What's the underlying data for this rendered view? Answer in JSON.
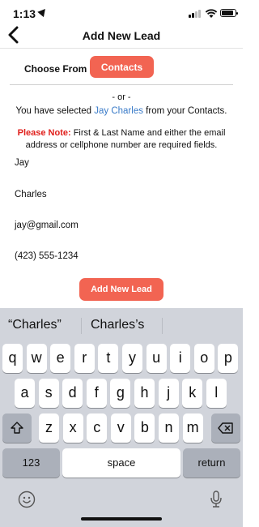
{
  "status": {
    "time": "1:13"
  },
  "nav": {
    "title": "Add New Lead"
  },
  "choose": {
    "label": "Choose From",
    "button": "Contacts"
  },
  "or_text": "- or -",
  "selected": {
    "prefix": "You have selected ",
    "name": "Jay Charles",
    "suffix": " from your Contacts."
  },
  "note": {
    "label": "Please Note:",
    "text": " First & Last Name and either the email address or cellphone number are required fields."
  },
  "fields": {
    "first_name": "Jay",
    "last_name": "Charles",
    "email": "jay@gmail.com",
    "phone": "(423) 555-1234"
  },
  "add_button": "Add New Lead",
  "keyboard": {
    "suggestions": [
      "“Charles”",
      "Charles’s"
    ],
    "row1": [
      "q",
      "w",
      "e",
      "r",
      "t",
      "y",
      "u",
      "i",
      "o",
      "p"
    ],
    "row2": [
      "a",
      "s",
      "d",
      "f",
      "g",
      "h",
      "j",
      "k",
      "l"
    ],
    "row3": [
      "z",
      "x",
      "c",
      "v",
      "b",
      "n",
      "m"
    ],
    "numbers_key": "123",
    "space_key": "space",
    "return_key": "return"
  },
  "colors": {
    "accent": "#f26452",
    "link": "#3a7bc8",
    "warning": "#e0201c"
  },
  "icons": [
    "location-arrow-icon",
    "signal-icon",
    "wifi-icon",
    "battery-icon",
    "back-chevron-icon",
    "shift-icon",
    "backspace-icon",
    "emoji-icon",
    "microphone-icon"
  ]
}
